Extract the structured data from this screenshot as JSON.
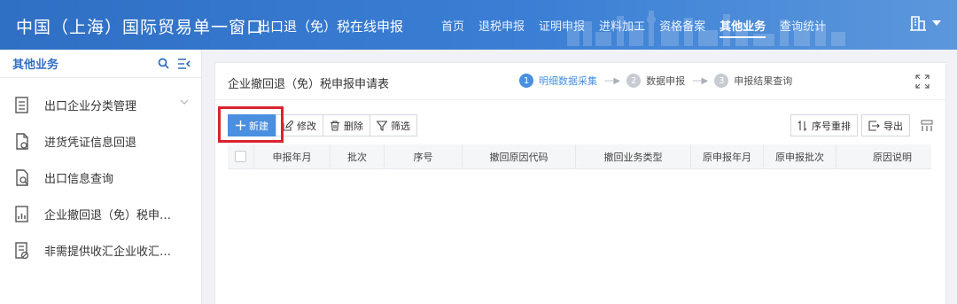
{
  "header": {
    "app_title": "中国（上海）国际贸易单一窗口",
    "app_subtitle": "出口退（免）税在线申报",
    "nav": [
      {
        "label": "首页",
        "active": false
      },
      {
        "label": "退税申报",
        "active": false
      },
      {
        "label": "证明申报",
        "active": false
      },
      {
        "label": "进料加工",
        "active": false
      },
      {
        "label": "资格备案",
        "active": false
      },
      {
        "label": "其他业务",
        "active": true
      },
      {
        "label": "查询统计",
        "active": false
      }
    ],
    "user_menu_icon": "building-icon"
  },
  "sidebar": {
    "title": "其他业务",
    "items": [
      {
        "label": "出口企业分类管理",
        "icon": "list-doc-icon",
        "expandable": true
      },
      {
        "label": "进货凭证信息回退",
        "icon": "doc-refresh-icon",
        "expandable": false
      },
      {
        "label": "出口信息查询",
        "icon": "doc-search-icon",
        "expandable": false
      },
      {
        "label": "企业撤回退（免）税申…",
        "icon": "doc-chart-icon",
        "expandable": false
      },
      {
        "label": "非需提供收汇企业收汇…",
        "icon": "doc-forbid-icon",
        "expandable": false
      }
    ]
  },
  "panel": {
    "title": "企业撤回退（免）税申报申请表",
    "steps": [
      {
        "num": "1",
        "label": "明细数据采集",
        "active": true
      },
      {
        "num": "2",
        "label": "数据申报",
        "active": false
      },
      {
        "num": "3",
        "label": "申报结果查询",
        "active": false
      }
    ],
    "step_separator": "----▶"
  },
  "toolbar": {
    "new_label": "新建",
    "edit_label": "修改",
    "delete_label": "删除",
    "filter_label": "筛选",
    "reorder_label": "序号重排",
    "export_label": "导出"
  },
  "table": {
    "columns": [
      "申报年月",
      "批次",
      "序号",
      "撤回原因代码",
      "撤回业务类型",
      "原申报年月",
      "原申报批次",
      "原因说明"
    ],
    "rows": []
  },
  "colors": {
    "header_blue": "#2f6fc4",
    "primary": "#4a8fe0",
    "highlight_red": "#d9232e"
  }
}
